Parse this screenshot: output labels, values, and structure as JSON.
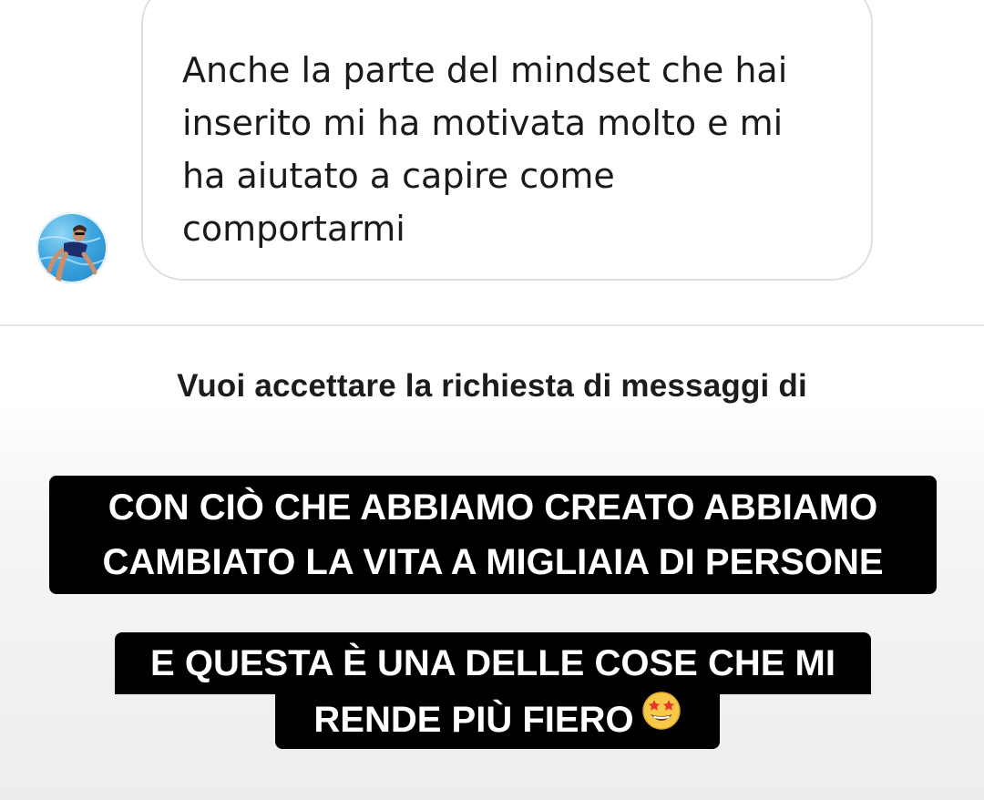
{
  "chat": {
    "message": "Anche la parte del mindset che hai\ninserito mi ha motivata molto e mi\nha aiutato a capire come\ncomportarmi",
    "avatar_icon": "profile-avatar"
  },
  "request": {
    "prompt": "Vuoi accettare la richiesta di messaggi di"
  },
  "captions": {
    "first_line1": "CON CIÒ CHE ABBIAMO CREATO ABBIAMO",
    "first_line2": "CAMBIATO LA VITA A MIGLIAIA DI PERSONE",
    "second_line1": "E QUESTA È UNA DELLE COSE CHE MI",
    "second_line2": "RENDE PIÙ FIERO",
    "emoji_icon": "star-struck-emoji"
  },
  "colors": {
    "caption_bg": "#000000",
    "caption_text": "#ffffff",
    "bubble_border": "#dfdfdf"
  }
}
